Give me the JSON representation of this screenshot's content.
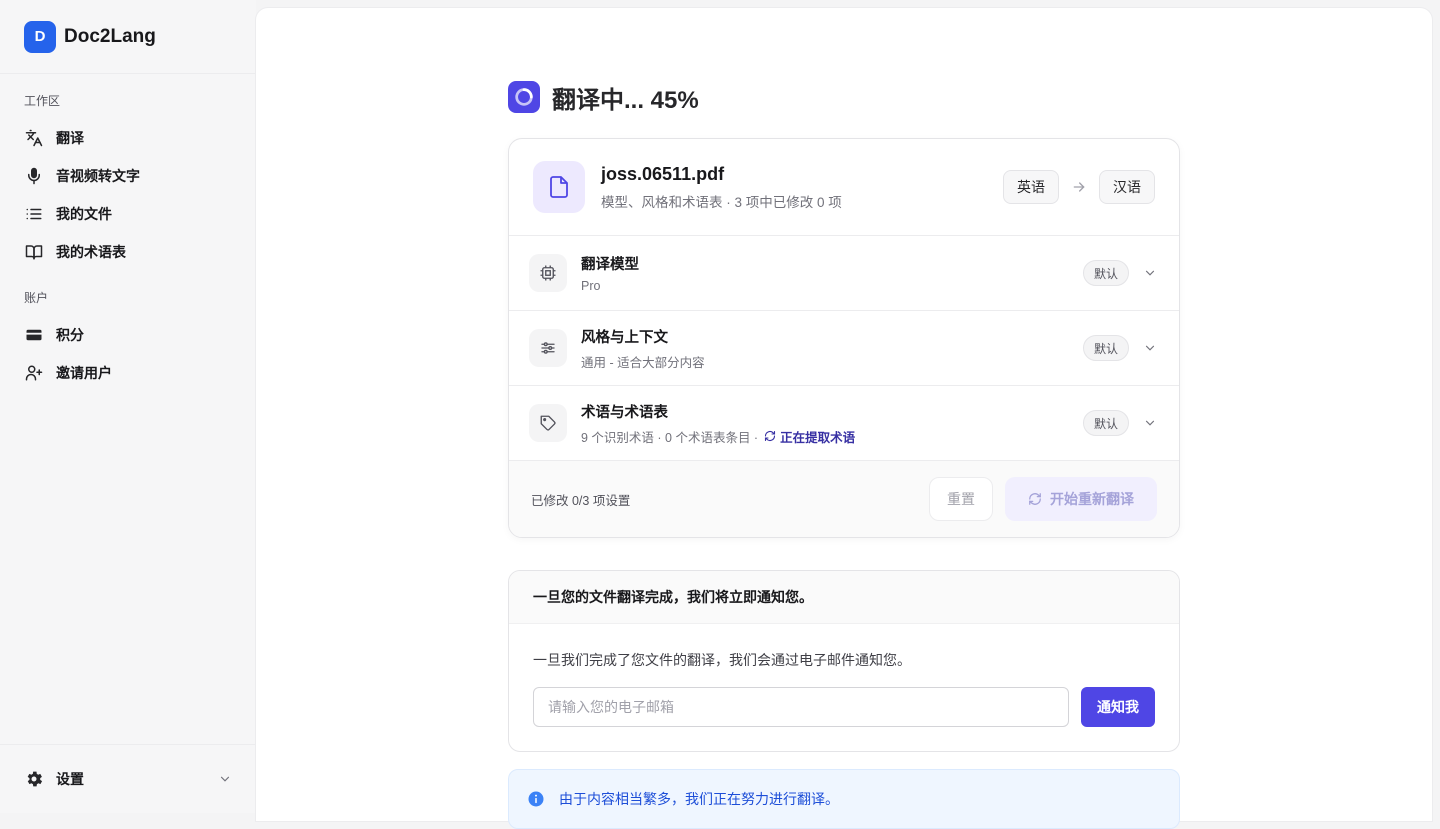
{
  "brand": {
    "logo_letter": "D",
    "name": "Doc2Lang"
  },
  "sidebar": {
    "workspace_heading": "工作区",
    "workspace_items": [
      {
        "label": "翻译",
        "icon": "translate-icon"
      },
      {
        "label": "音视频转文字",
        "icon": "microphone-icon"
      },
      {
        "label": "我的文件",
        "icon": "list-icon"
      },
      {
        "label": "我的术语表",
        "icon": "book-icon"
      }
    ],
    "account_heading": "账户",
    "account_items": [
      {
        "label": "积分",
        "icon": "credit-card-icon"
      },
      {
        "label": "邀请用户",
        "icon": "user-plus-icon"
      }
    ],
    "settings_label": "设置"
  },
  "main": {
    "title": "翻译中... 45%",
    "progress_percent": 45,
    "file": {
      "name": "joss.06511.pdf",
      "subtitle": "模型、风格和术语表 · 3 项中已修改 0 项",
      "source_lang": "英语",
      "target_lang": "汉语"
    },
    "settings": [
      {
        "title": "翻译模型",
        "sub": "Pro",
        "badge": "默认",
        "icon": "cpu-icon"
      },
      {
        "title": "风格与上下文",
        "sub": "通用 - 适合大部分内容",
        "badge": "默认",
        "icon": "sliders-icon"
      },
      {
        "title": "术语与术语表",
        "sub": "9 个识别术语 · 0 个术语表条目 ·",
        "extracting": "正在提取术语",
        "badge": "默认",
        "icon": "tag-icon"
      }
    ],
    "footer": {
      "modified_text": "已修改 0/3 项设置",
      "reset_label": "重置",
      "retranslate_label": "开始重新翻译"
    },
    "notify": {
      "heading": "一旦您的文件翻译完成，我们将立即通知您。",
      "description": "一旦我们完成了您文件的翻译，我们会通过电子邮件通知您。",
      "email_placeholder": "请输入您的电子邮箱",
      "email_value": "",
      "button_label": "通知我"
    },
    "info_banner": "由于内容相当繁多，我们正在努力进行翻译。"
  },
  "colors": {
    "accent": "#4f46e5",
    "brand": "#2563eb",
    "info_text": "#1d4ed8",
    "info_bg": "#eff6ff"
  }
}
